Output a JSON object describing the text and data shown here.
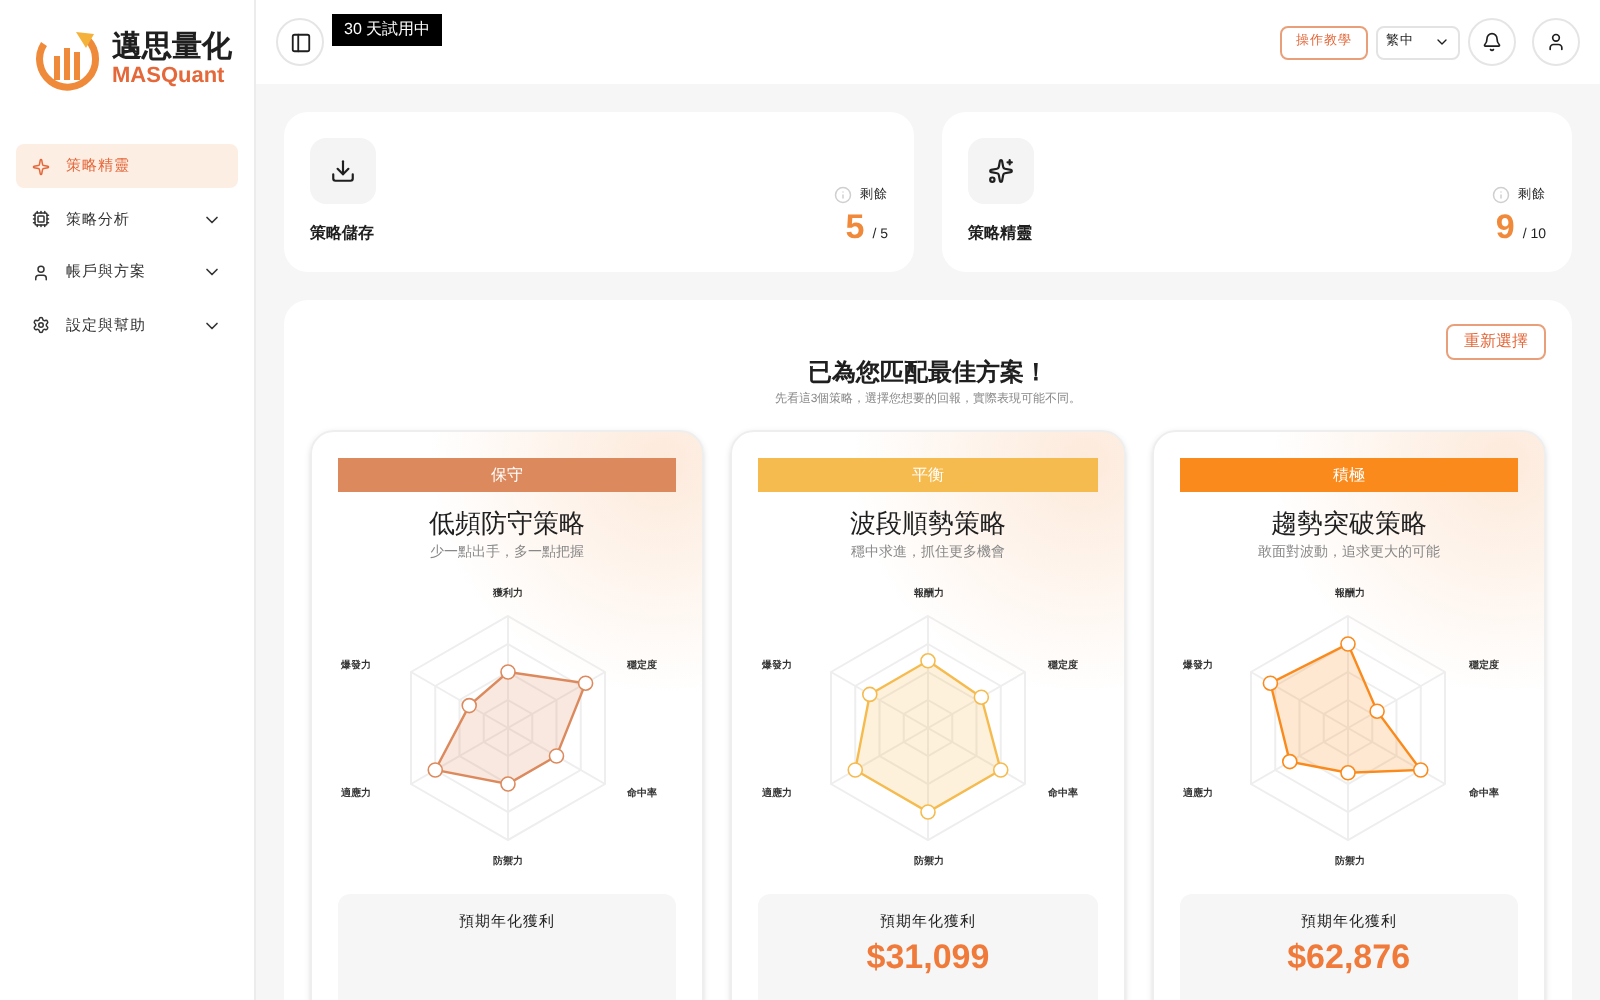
{
  "brand": {
    "name": "邁思量化",
    "sub": "MASQuant"
  },
  "sidebar": {
    "items": [
      {
        "label": "策略精靈",
        "selected": true,
        "expandable": false
      },
      {
        "label": "策略分析",
        "selected": false,
        "expandable": true
      },
      {
        "label": "帳戶與方案",
        "selected": false,
        "expandable": true
      },
      {
        "label": "設定與幫助",
        "selected": false,
        "expandable": true
      }
    ]
  },
  "header": {
    "trial_badge": "30 天試用中",
    "tutorial_button": "操作教學",
    "language": "繁中"
  },
  "stats": [
    {
      "title": "策略儲存",
      "remaining_label": "剩餘",
      "value": "5",
      "total": "/ 5"
    },
    {
      "title": "策略精靈",
      "remaining_label": "剩餘",
      "value": "9",
      "total": "/ 10"
    }
  ],
  "match": {
    "reselect_button": "重新選擇",
    "title": "已為您匹配最佳方案！",
    "subtitle": "先看這3個策略，選擇您想要的回報，實際表現可能不同。",
    "strategies": [
      {
        "tag": "保守",
        "color": "#dc8a5d",
        "name": "低頻防守策略",
        "tagline": "少一點出手，多一點把握",
        "axes": [
          "獲利力",
          "穩定度",
          "命中率",
          "防禦力",
          "適應力",
          "爆發力"
        ],
        "profit_label": "預期年化獲利"
      },
      {
        "tag": "平衡",
        "color": "#f6bb4e",
        "name": "波段順勢策略",
        "tagline": "穩中求進，抓住更多機會",
        "axes": [
          "報酬力",
          "穩定度",
          "命中率",
          "防禦力",
          "適應力",
          "爆發力"
        ],
        "profit_label": "預期年化獲利",
        "profit": "$31,099"
      },
      {
        "tag": "積極",
        "color": "#fb8a1c",
        "name": "趨勢突破策略",
        "tagline": "敢面對波動，追求更大的可能",
        "axes": [
          "報酬力",
          "穩定度",
          "命中率",
          "防禦力",
          "適應力",
          "爆發力"
        ],
        "profit_label": "預期年化獲利",
        "profit": "$62,876"
      }
    ]
  }
}
